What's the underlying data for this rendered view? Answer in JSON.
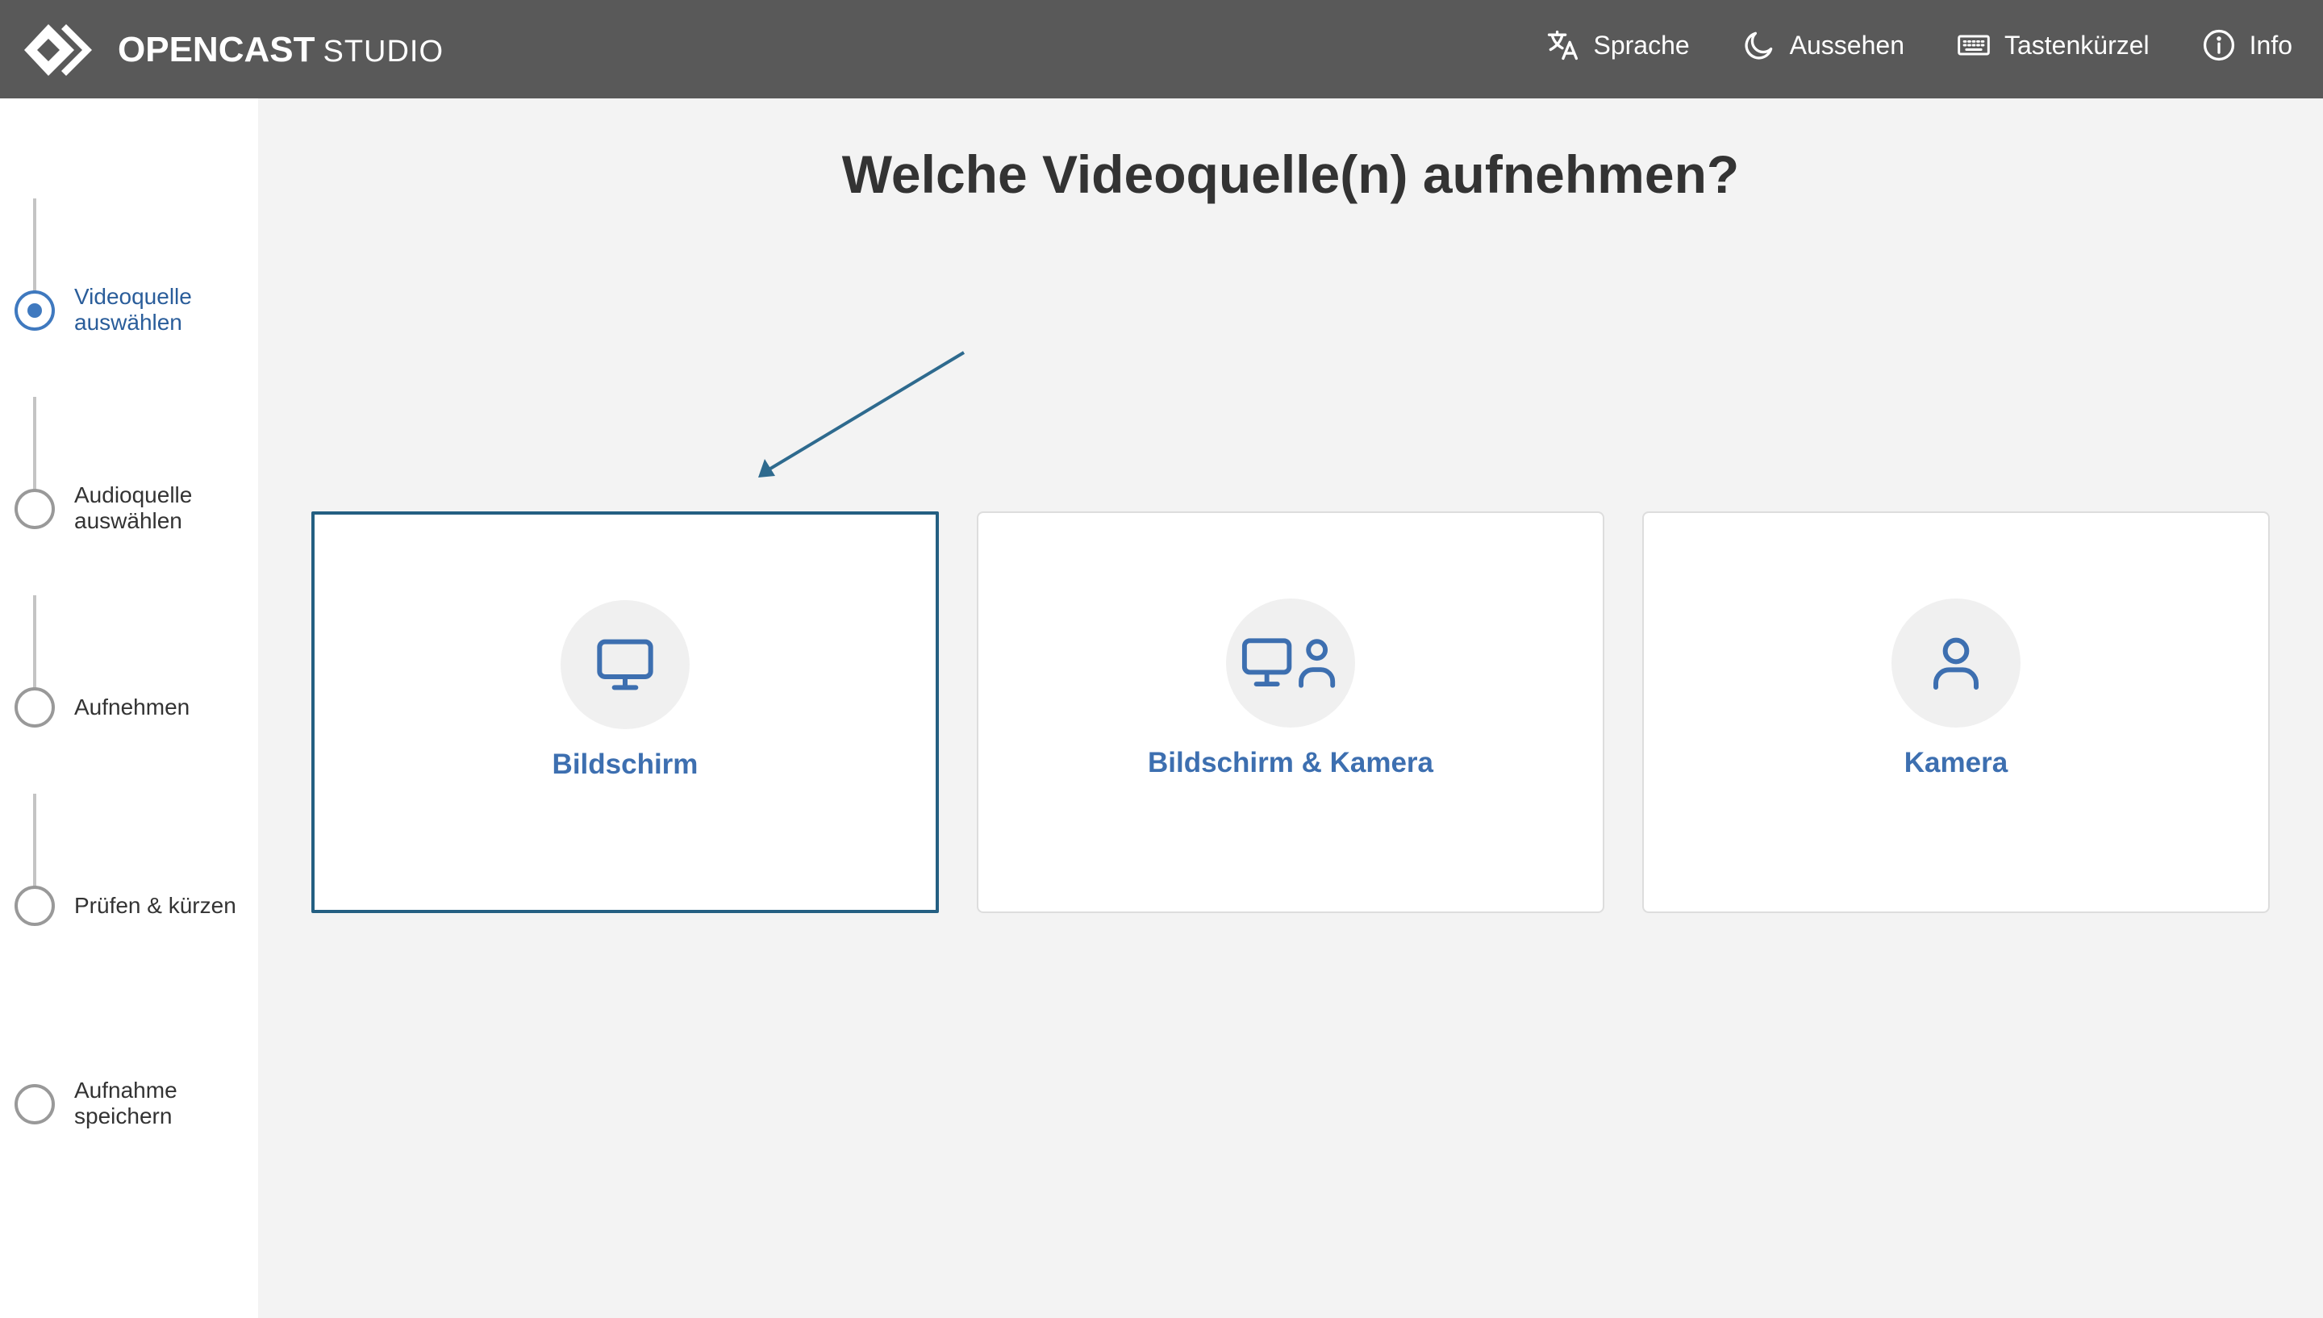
{
  "app": {
    "logo_word": "OPENCAST",
    "logo_sub": "STUDIO"
  },
  "nav": {
    "items": [
      {
        "label": "Sprache",
        "icon": "translate-icon"
      },
      {
        "label": "Aussehen",
        "icon": "moon-icon"
      },
      {
        "label": "Tastenkürzel",
        "icon": "keyboard-icon"
      },
      {
        "label": "Info",
        "icon": "info-icon"
      }
    ]
  },
  "steps": [
    {
      "label": "Videoquelle auswählen",
      "state": "active"
    },
    {
      "label": "Audioquelle auswählen",
      "state": "pending"
    },
    {
      "label": "Aufnehmen",
      "state": "pending"
    },
    {
      "label": "Prüfen & kürzen",
      "state": "pending"
    },
    {
      "label": "Aufnahme speichern",
      "state": "pending"
    }
  ],
  "main": {
    "title": "Welche Videoquelle(n) aufnehmen?",
    "options": [
      {
        "label": "Bildschirm",
        "icon": "monitor-icon",
        "selected": true
      },
      {
        "label": "Bildschirm & Kamera",
        "icon": "monitor-user-icon",
        "selected": false
      },
      {
        "label": "Kamera",
        "icon": "user-icon",
        "selected": false
      }
    ]
  },
  "colors": {
    "header_bg": "#595959",
    "accent": "#3d6fb0",
    "selected_border": "#245f82",
    "arrow": "#2e6a8e"
  }
}
